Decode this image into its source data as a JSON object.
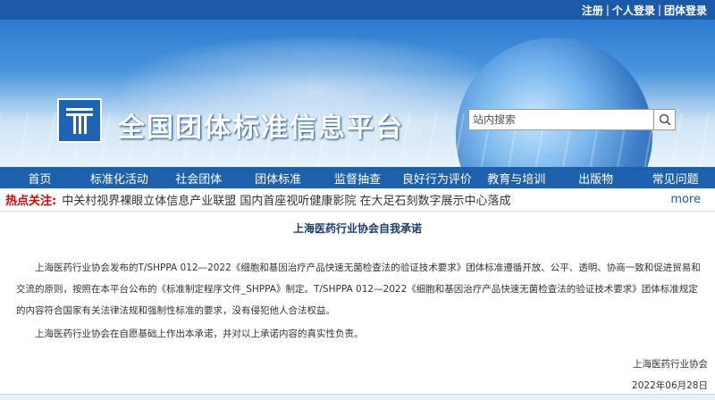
{
  "topbar": {
    "links": [
      "注册",
      "个人登录",
      "团体登录"
    ]
  },
  "header": {
    "site_title": "全国团体标准信息平台"
  },
  "search": {
    "placeholder": "站内搜索"
  },
  "nav": {
    "items": [
      "首页",
      "标准化活动",
      "社会团体",
      "团体标准",
      "监督抽查",
      "良好行为评价",
      "教育与培训",
      "出版物",
      "常见问题"
    ]
  },
  "ticker": {
    "label": "热点关注:",
    "news": "中关村视界裸眼立体信息产业联盟 国内首座视听健康影院 在大足石刻数字展示中心落成",
    "more": "more"
  },
  "article": {
    "title": "上海医药行业协会自我承诺",
    "p1": "上海医药行业协会发布的T/SHPPA 012—2022《细胞和基因治疗产品快速无菌检查法的验证技术要求》团体标准遵循开放、公平、透明、协商一致和促进贸易和交流的原则，按照在本平台公布的《标准制定程序文件_SHPPA》制定。T/SHPPA 012—2022《细胞和基因治疗产品快速无菌检查法的验证技术要求》团体标准规定的内容符合国家有关法律法规和强制性标准的要求，没有侵犯他人合法权益。",
    "p2": "上海医药行业协会在自愿基础上作出本承诺，并对以上承诺内容的真实性负责。",
    "signer": "上海医药行业协会",
    "date": "2022年06月28日"
  }
}
